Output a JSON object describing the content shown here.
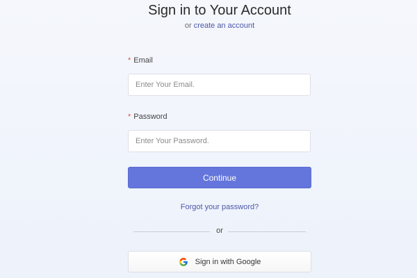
{
  "header": {
    "title": "Sign in to Your Account",
    "subtitle_prefix": "or",
    "create_account_link": "create an account"
  },
  "form": {
    "email": {
      "required_mark": "*",
      "label": "Email",
      "placeholder": "Enter Your Email.",
      "value": ""
    },
    "password": {
      "required_mark": "*",
      "label": "Password",
      "placeholder": "Enter Your Password.",
      "value": ""
    },
    "continue_label": "Continue",
    "forgot_password_link": "Forgot your password?"
  },
  "divider": {
    "text": "or"
  },
  "social": {
    "google_label": "Sign in with Google",
    "google_icon": "google-icon"
  },
  "colors": {
    "accent": "#6476dc",
    "link": "#4b57a8",
    "required": "#d9534f"
  }
}
